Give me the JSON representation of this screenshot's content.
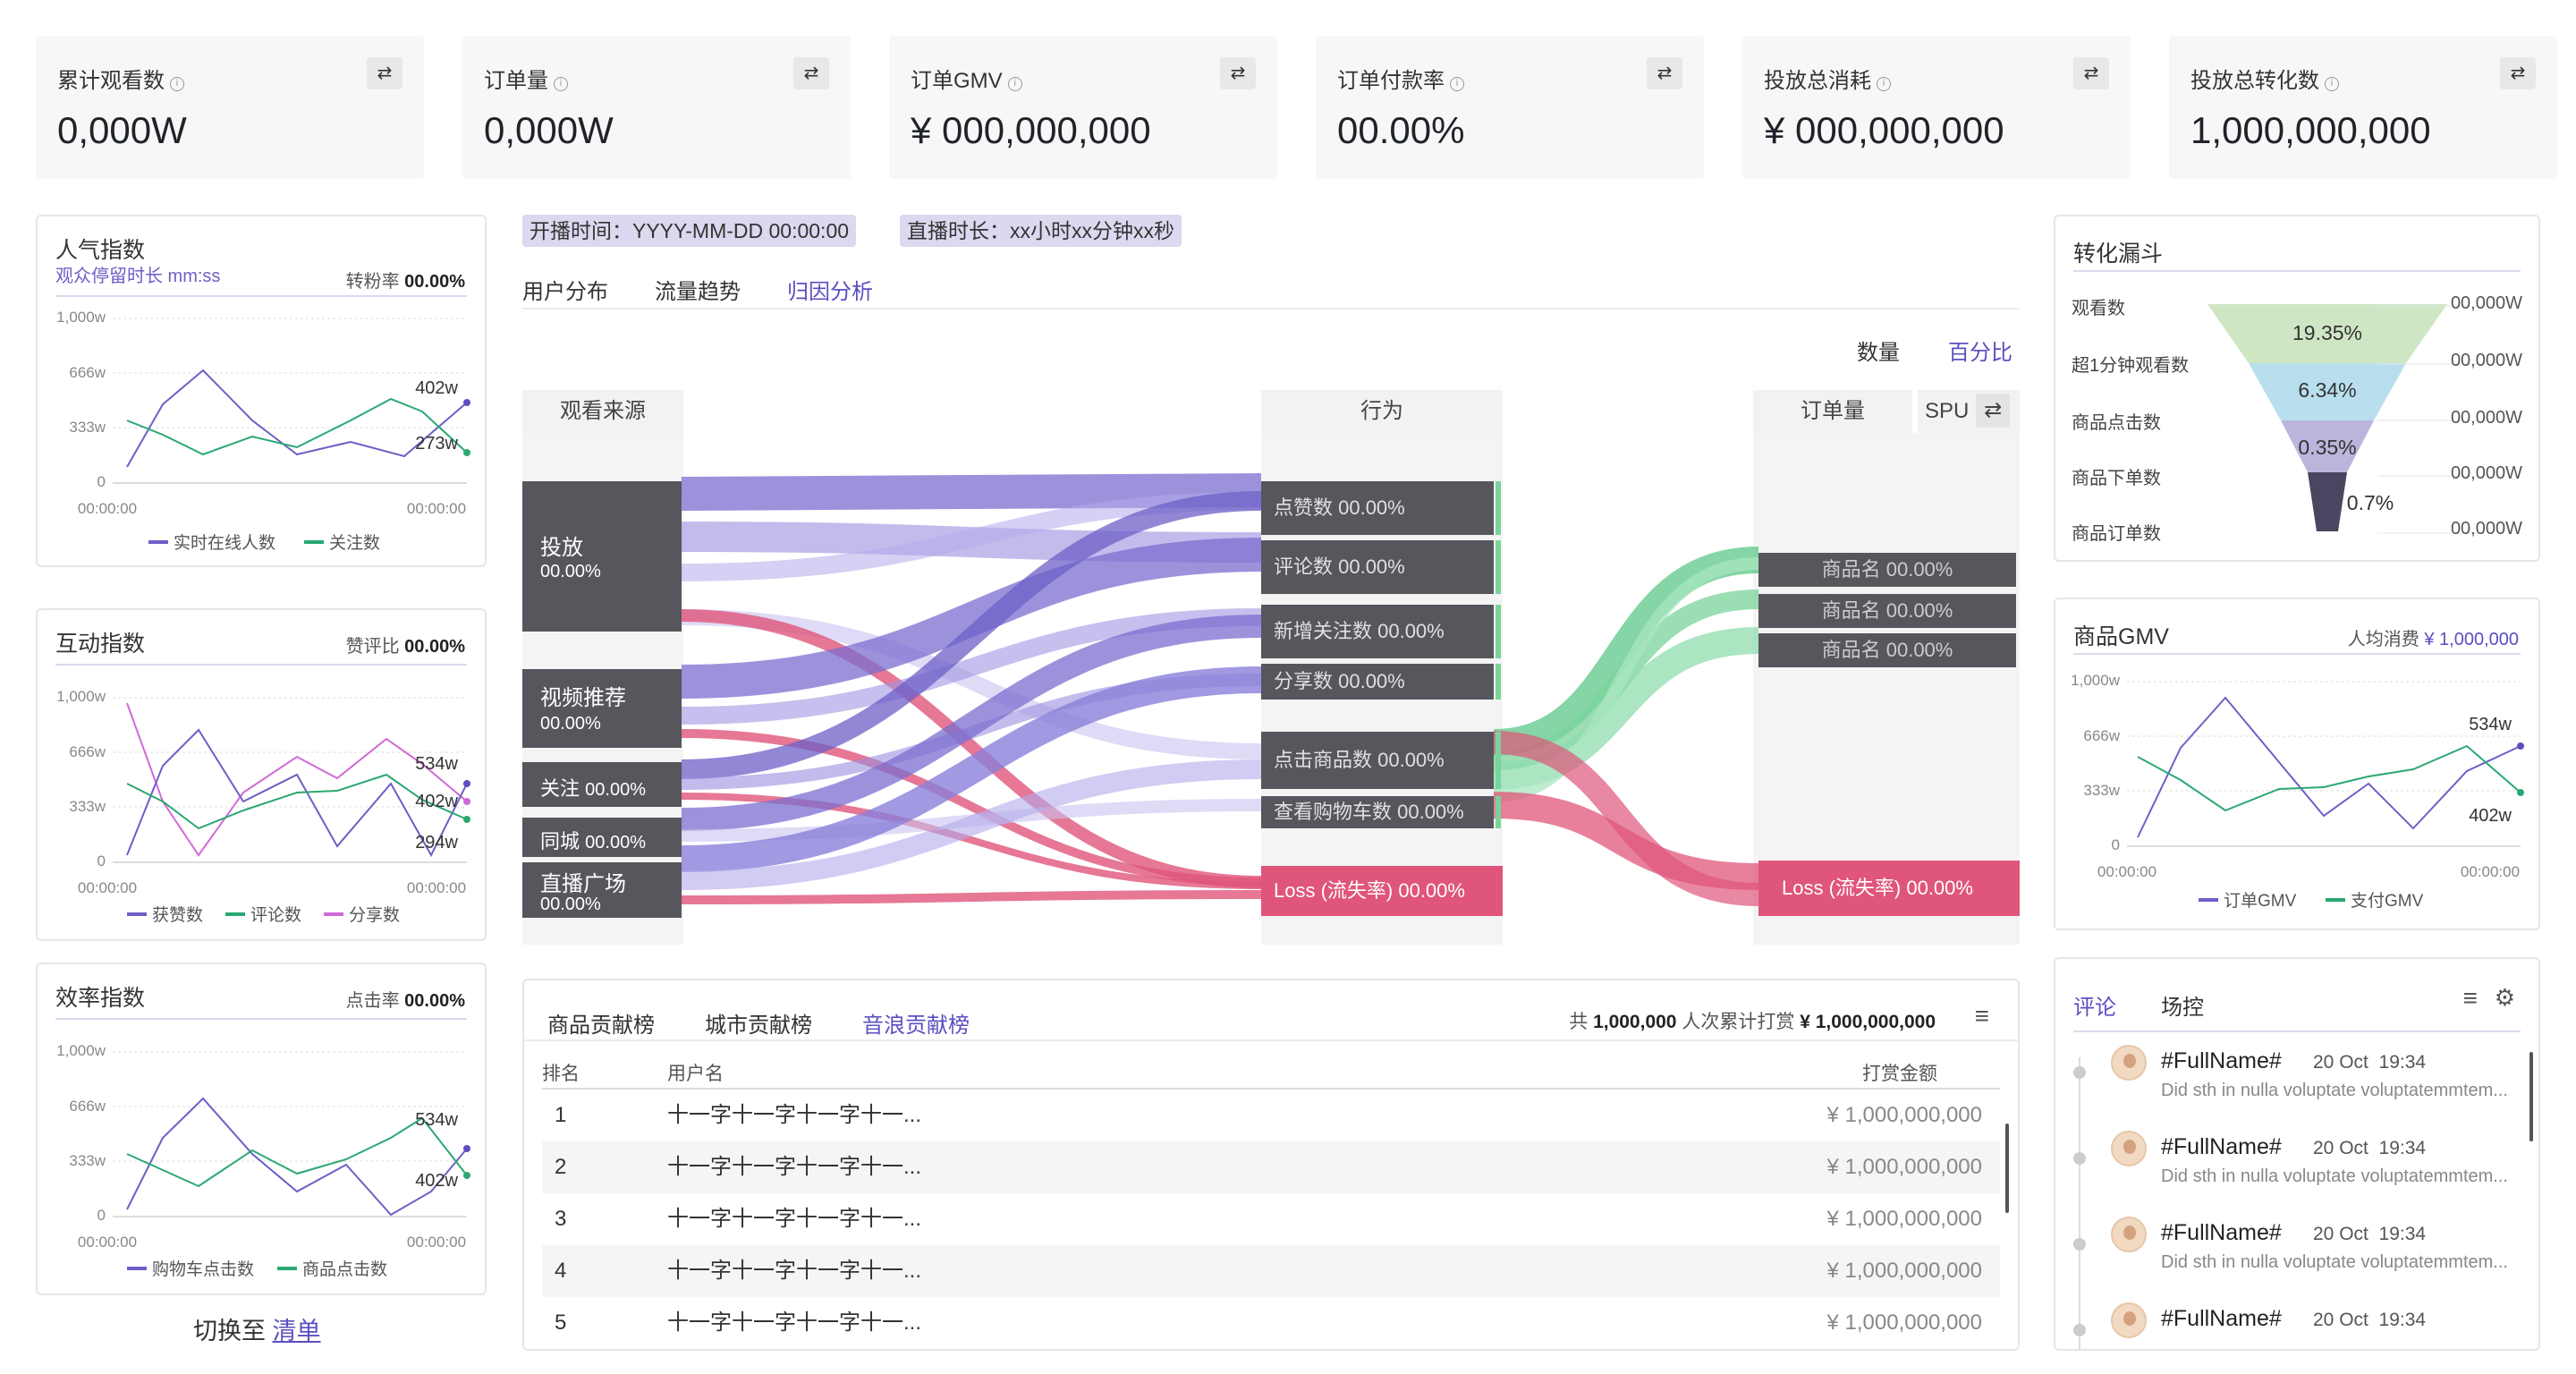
{
  "kpis": [
    {
      "label": "累计观看数",
      "value": "0,000W"
    },
    {
      "label": "订单量",
      "value": "0,000W"
    },
    {
      "label": "订单GMV",
      "value": "¥ 000,000,000"
    },
    {
      "label": "订单付款率",
      "value": "00.00%"
    },
    {
      "label": "投放总消耗",
      "value": "¥ 000,000,000"
    },
    {
      "label": "投放总转化数",
      "value": "1,000,000,000"
    }
  ],
  "popularity": {
    "title": "人气指数",
    "sub": "观众停留时长 mm:ss",
    "rate_label": "转粉率",
    "rate_value": "00.00%",
    "legend": [
      "实时在线人数",
      "关注数"
    ],
    "end_labels": [
      "402w",
      "273w"
    ]
  },
  "interaction": {
    "title": "互动指数",
    "rate_label": "赞评比",
    "rate_value": "00.00%",
    "legend": [
      "获赞数",
      "评论数",
      "分享数"
    ],
    "end_labels": [
      "534w",
      "402w",
      "294w"
    ]
  },
  "efficiency": {
    "title": "效率指数",
    "rate_label": "点击率",
    "rate_value": "00.00%",
    "legend": [
      "购物车点击数",
      "商品点击数"
    ],
    "end_labels": [
      "534w",
      "402w"
    ]
  },
  "axis": {
    "y": [
      "1,000w",
      "666w",
      "333w",
      "0"
    ],
    "x": [
      "00:00:00",
      "00:00:00"
    ]
  },
  "switch": {
    "label": "切换至",
    "link": "清单"
  },
  "live": {
    "start": "开播时间：YYYY-MM-DD 00:00:00",
    "duration": "直播时长：xx小时xx分钟xx秒"
  },
  "tabs": [
    "用户分布",
    "流量趋势",
    "归因分析"
  ],
  "toggle": {
    "count": "数量",
    "percent": "百分比"
  },
  "sankey": {
    "headers": {
      "source": "观看来源",
      "action": "行为",
      "orders": "订单量",
      "spu": "SPU"
    },
    "sources": [
      {
        "name": "投放",
        "pct": "00.00%"
      },
      {
        "name": "视频推荐",
        "pct": "00.00%"
      },
      {
        "name": "关注",
        "pct": "00.00%"
      },
      {
        "name": "同城",
        "pct": "00.00%"
      },
      {
        "name": "直播广场",
        "pct": "00.00%"
      }
    ],
    "actions": [
      "点赞数 00.00%",
      "评论数 00.00%",
      "新增关注数 00.00%",
      "分享数 00.00%",
      "点击商品数 00.00%",
      "查看购物车数 00.00%"
    ],
    "loss": "Loss (流失率) 00.00%",
    "products": [
      "商品名 00.00%",
      "商品名 00.00%",
      "商品名 00.00%"
    ]
  },
  "ranking": {
    "tabs": [
      "商品贡献榜",
      "城市贡献榜",
      "音浪贡献榜"
    ],
    "summary_pre": "共",
    "count": "1,000,000",
    "summary_mid": "人次累计打赏",
    "amount": "¥ 1,000,000,000",
    "cols": [
      "排名",
      "用户名",
      "打赏金额"
    ],
    "rows": [
      {
        "rank": "1",
        "user": "十一字十一字十一字十一...",
        "money": "¥ 1,000,000,000"
      },
      {
        "rank": "2",
        "user": "十一字十一字十一字十一...",
        "money": "¥ 1,000,000,000"
      },
      {
        "rank": "3",
        "user": "十一字十一字十一字十一...",
        "money": "¥ 1,000,000,000"
      },
      {
        "rank": "4",
        "user": "十一字十一字十一字十一...",
        "money": "¥ 1,000,000,000"
      },
      {
        "rank": "5",
        "user": "十一字十一字十一字十一...",
        "money": "¥ 1,000,000,000"
      }
    ]
  },
  "funnel": {
    "title": "转化漏斗",
    "steps": [
      "观看数",
      "超1分钟观看数",
      "商品点击数",
      "商品下单数",
      "商品订单数"
    ],
    "values": [
      "00,000W",
      "00,000W",
      "00,000W",
      "00,000W",
      "00,000W"
    ],
    "rates": [
      "19.35%",
      "6.34%",
      "0.35%",
      "0.7%"
    ]
  },
  "gmv": {
    "title": "商品GMV",
    "avg_label": "人均消费",
    "avg_value": "¥ 1,000,000",
    "legend": [
      "订单GMV",
      "支付GMV"
    ],
    "end_labels": [
      "534w",
      "402w"
    ]
  },
  "comments": {
    "tabs": [
      "评论",
      "场控"
    ],
    "items": [
      {
        "name": "#FullName#",
        "date": "20 Oct",
        "time": "19:34",
        "text": "Did sth in nulla voluptate voluptatemmtem..."
      },
      {
        "name": "#FullName#",
        "date": "20 Oct",
        "time": "19:34",
        "text": "Did sth in nulla voluptate voluptatemmtem..."
      },
      {
        "name": "#FullName#",
        "date": "20 Oct",
        "time": "19:34",
        "text": "Did sth in nulla voluptate voluptatemmtem..."
      },
      {
        "name": "#FullName#",
        "date": "20 Oct",
        "time": "19:34",
        "text": ""
      }
    ]
  },
  "colors": {
    "accent": "#5b4fc0",
    "purple": "#6c5fc7",
    "green": "#2aa872",
    "pink": "#d06ad6",
    "loss": "#e0557a"
  }
}
